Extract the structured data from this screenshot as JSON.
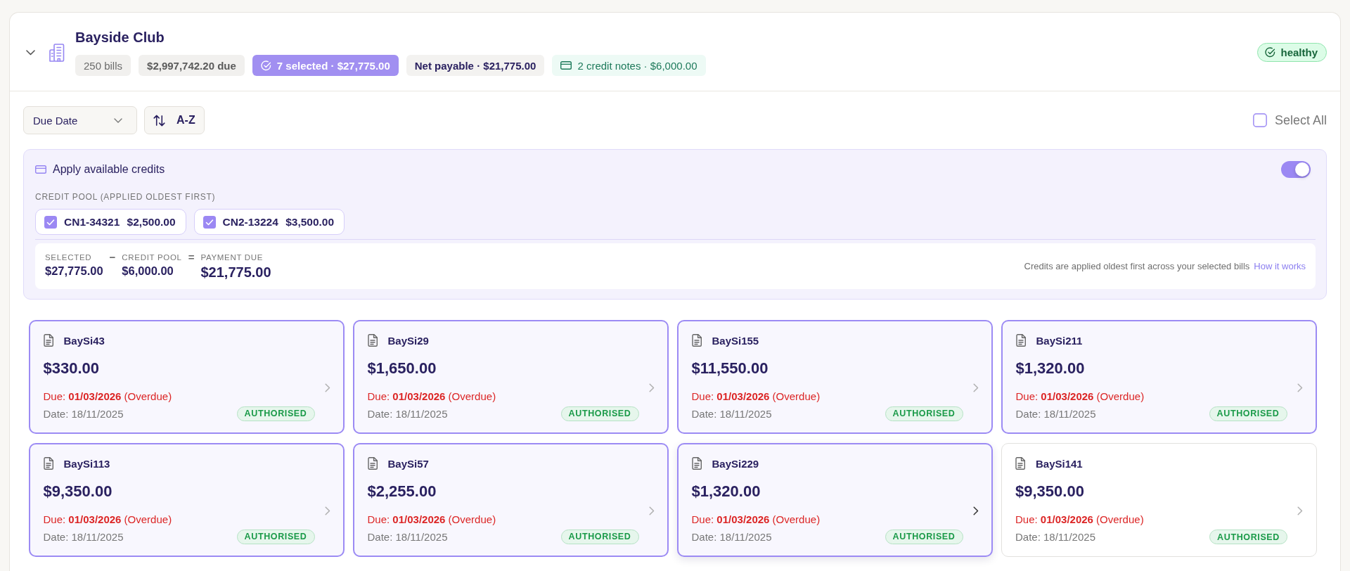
{
  "account": {
    "name": "Bayside Club",
    "expanded": true,
    "stats": [
      {
        "kind": "count",
        "text": "250 bills"
      },
      {
        "kind": "due",
        "text": "$2,997,742.20 due"
      },
      {
        "kind": "selected",
        "text": "7 selected · $27,775.00"
      },
      {
        "kind": "net",
        "text": "Net payable · $21,775.00"
      },
      {
        "kind": "credit",
        "text": "2 credit notes · $6,000.00"
      }
    ],
    "health": "healthy"
  },
  "toolbar": {
    "sort_field": "Due Date",
    "sort_order": "A-Z",
    "select_all": {
      "label": "Select All",
      "checked": false
    }
  },
  "credits": {
    "title": "Apply available credits",
    "on": true,
    "pool_label": "CREDIT POOL (APPLIED OLDEST FIRST)",
    "notes": [
      {
        "id": "CN1-34321",
        "amount": "$2,500.00",
        "checked": true
      },
      {
        "id": "CN2-13224",
        "amount": "$3,500.00",
        "checked": true
      }
    ],
    "equation": [
      {
        "kind": "term",
        "label": "SELECTED",
        "value": "$27,775.00"
      },
      {
        "kind": "operator",
        "text": "−"
      },
      {
        "kind": "term",
        "label": "CREDIT POOL",
        "value": "$6,000.00"
      },
      {
        "kind": "operator",
        "text": "="
      },
      {
        "kind": "total",
        "label": "PAYMENT DUE",
        "value": "$21,775.00"
      }
    ],
    "note": "Credits are applied oldest first across your selected bills",
    "link": "How it works"
  },
  "cards": [
    {
      "number": "BaySi43",
      "amount": "$330.00",
      "due": "Due: **01/03/2026** (Overdue)",
      "overdue": true,
      "date": "Date: 18/11/2025",
      "status": "AUTHORISED",
      "selected": true,
      "hovered": false
    },
    {
      "number": "BaySi29",
      "amount": "$1,650.00",
      "due": "Due: **01/03/2026** (Overdue)",
      "overdue": true,
      "date": "Date: 18/11/2025",
      "status": "AUTHORISED",
      "selected": true,
      "hovered": false
    },
    {
      "number": "BaySi155",
      "amount": "$11,550.00",
      "due": "Due: **01/03/2026** (Overdue)",
      "overdue": true,
      "date": "Date: 18/11/2025",
      "status": "AUTHORISED",
      "selected": true,
      "hovered": false
    },
    {
      "number": "BaySi211",
      "amount": "$1,320.00",
      "due": "Due: **01/03/2026** (Overdue)",
      "overdue": true,
      "date": "Date: 18/11/2025",
      "status": "AUTHORISED",
      "selected": true,
      "hovered": false
    },
    {
      "number": "BaySi113",
      "amount": "$9,350.00",
      "due": "Due: **01/03/2026** (Overdue)",
      "overdue": true,
      "date": "Date: 18/11/2025",
      "status": "AUTHORISED",
      "selected": true,
      "hovered": false
    },
    {
      "number": "BaySi57",
      "amount": "$2,255.00",
      "due": "Due: **01/03/2026** (Overdue)",
      "overdue": true,
      "date": "Date: 18/11/2025",
      "status": "AUTHORISED",
      "selected": true,
      "hovered": false
    },
    {
      "number": "BaySi229",
      "amount": "$1,320.00",
      "due": "Due: **01/03/2026** (Overdue)",
      "overdue": true,
      "date": "Date: 18/11/2025",
      "status": "AUTHORISED",
      "selected": true,
      "hovered": true
    },
    {
      "number": "BaySi141",
      "amount": "$9,350.00",
      "due": "Due: **01/03/2026** (Overdue)",
      "overdue": true,
      "date": "Date: 18/11/2025",
      "status": "AUTHORISED",
      "selected": false,
      "hovered": false
    }
  ]
}
